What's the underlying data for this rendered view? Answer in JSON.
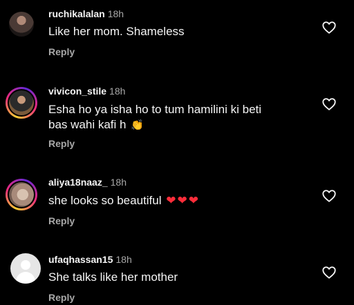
{
  "comments": [
    {
      "username": "ruchikalalan",
      "time": "18h",
      "text": "Like her mom. Shameless",
      "reply_label": "Reply"
    },
    {
      "username": "vivicon_stile",
      "time": "18h",
      "text_line1": "Esha ho ya isha ho to tum hamilini ki beti",
      "text_line2": "bas wahi kafi h",
      "emoji": "👏",
      "reply_label": "Reply"
    },
    {
      "username": "aliya18naaz_",
      "time": "18h",
      "text": "she looks so beautiful",
      "hearts": [
        "❤",
        "❤",
        "❤"
      ],
      "reply_label": "Reply"
    },
    {
      "username": "ufaqhassan15",
      "time": "18h",
      "text": "She talks like her mother",
      "reply_label": "Reply"
    }
  ],
  "icons": {
    "like": "heart-outline-icon",
    "heart_emoji_color": "#ff2d3a"
  }
}
